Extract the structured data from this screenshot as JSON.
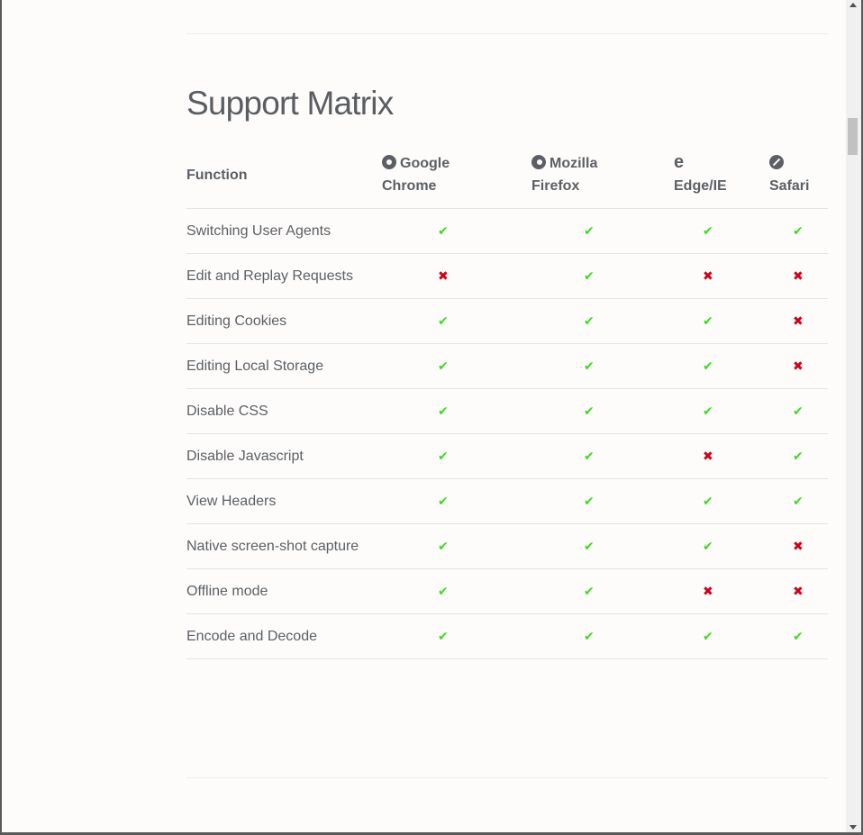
{
  "section": {
    "title": "Support Matrix"
  },
  "table": {
    "headers": {
      "function": "Function",
      "chrome_line1": "Google",
      "chrome_line2": "Chrome",
      "firefox_line1": "Mozilla",
      "firefox_line2": "Firefox",
      "edge_line1": "",
      "edge_line2": "Edge/IE",
      "safari_line1": "",
      "safari_line2": "Safari"
    },
    "icons": {
      "chrome": "chrome-icon",
      "firefox": "firefox-icon",
      "edge": "edge-icon",
      "safari": "safari-icon"
    },
    "symbols": {
      "yes": "✔",
      "no": "✖"
    },
    "colors": {
      "yes": "#3bdc1f",
      "no": "#d0021b"
    },
    "rows": [
      {
        "function": "Switching User Agents",
        "chrome": "✔",
        "firefox": "✔",
        "edge": "✔",
        "safari": "✔"
      },
      {
        "function": "Edit and Replay Requests",
        "chrome": "✖",
        "firefox": "✔",
        "edge": "✖",
        "safari": "✖"
      },
      {
        "function": "Editing Cookies",
        "chrome": "✔",
        "firefox": "✔",
        "edge": "✔",
        "safari": "✖"
      },
      {
        "function": "Editing Local Storage",
        "chrome": "✔",
        "firefox": "✔",
        "edge": "✔",
        "safari": "✖"
      },
      {
        "function": "Disable CSS",
        "chrome": "✔",
        "firefox": "✔",
        "edge": "✔",
        "safari": "✔"
      },
      {
        "function": "Disable Javascript",
        "chrome": "✔",
        "firefox": "✔",
        "edge": "✖",
        "safari": "✔"
      },
      {
        "function": "View Headers",
        "chrome": "✔",
        "firefox": "✔",
        "edge": "✔",
        "safari": "✔"
      },
      {
        "function": "Native screen-shot capture",
        "chrome": "✔",
        "firefox": "✔",
        "edge": "✔",
        "safari": "✖"
      },
      {
        "function": "Offline mode",
        "chrome": "✔",
        "firefox": "✔",
        "edge": "✖",
        "safari": "✖"
      },
      {
        "function": "Encode and Decode",
        "chrome": "✔",
        "firefox": "✔",
        "edge": "✔",
        "safari": "✔"
      }
    ]
  }
}
